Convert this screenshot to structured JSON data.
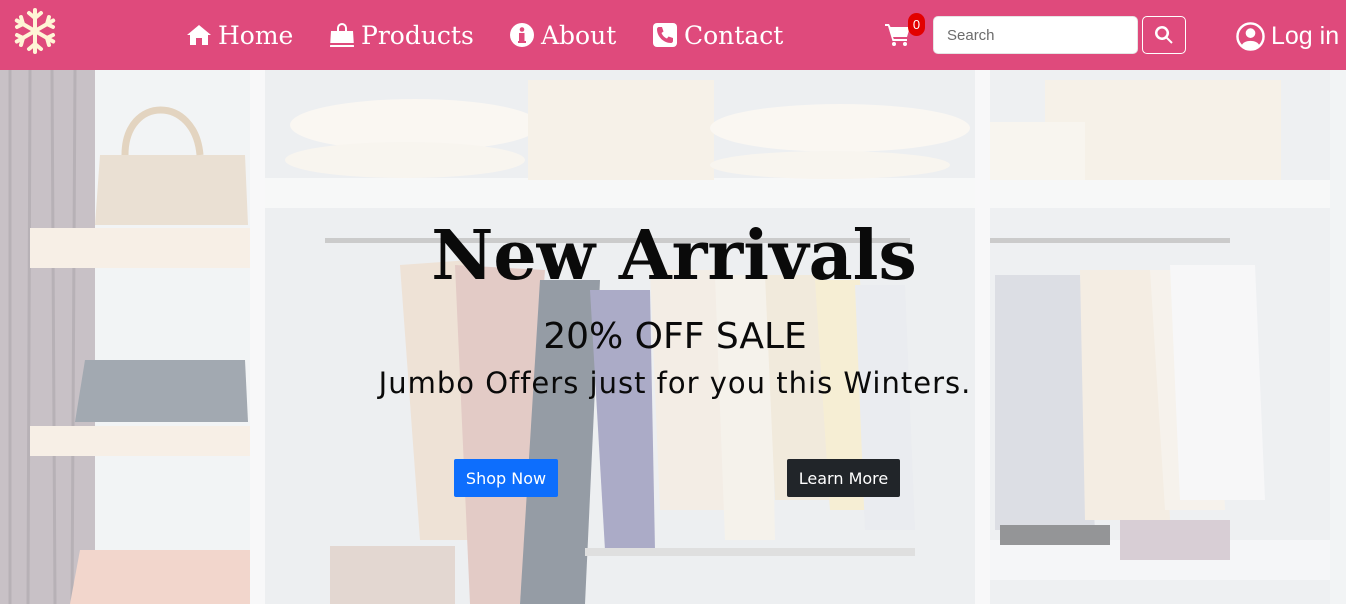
{
  "navbar": {
    "logo_icon": "snowflake-icon",
    "links": [
      {
        "label": "Home",
        "icon": "home-icon"
      },
      {
        "label": "Products",
        "icon": "shopping-bag-icon"
      },
      {
        "label": "About",
        "icon": "info-circle-icon"
      },
      {
        "label": "Contact",
        "icon": "phone-square-icon"
      }
    ],
    "cart_count": "0",
    "search_placeholder": "Search",
    "search_value": "",
    "login_label": "Log in",
    "colors": {
      "background": "#df4a7c",
      "badge": "#e30000",
      "text": "#ffffff",
      "logo": "#fff5d6"
    }
  },
  "hero": {
    "title": "New Arrivals",
    "subtitle": "20% OFF SALE",
    "tagline": "Jumbo Offers just for you this Winters.",
    "primary_button": "Shop Now",
    "secondary_button": "Learn More",
    "colors": {
      "primary": "#0d6efd",
      "secondary": "#212529"
    }
  }
}
